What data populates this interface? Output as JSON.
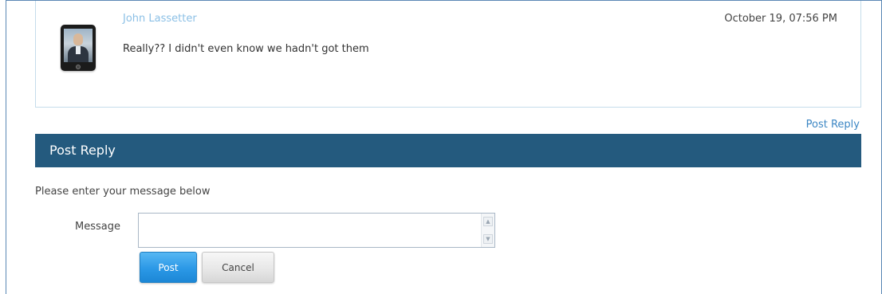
{
  "comment": {
    "author": "John Lassetter",
    "timestamp": "October 19, 07:56 PM",
    "text": "Really?? I didn't even know we hadn't got them",
    "avatar_icon": "tablet-avatar-icon"
  },
  "reply": {
    "link_label": "Post Reply",
    "header_title": "Post Reply",
    "instruction": "Please enter your message below",
    "message_label": "Message",
    "message_value": "",
    "post_label": "Post",
    "cancel_label": "Cancel"
  },
  "colors": {
    "header_bg": "#245a7e",
    "author_link": "#8cc0e6",
    "reply_link": "#3d87c4",
    "post_button": "#2b98e6"
  }
}
